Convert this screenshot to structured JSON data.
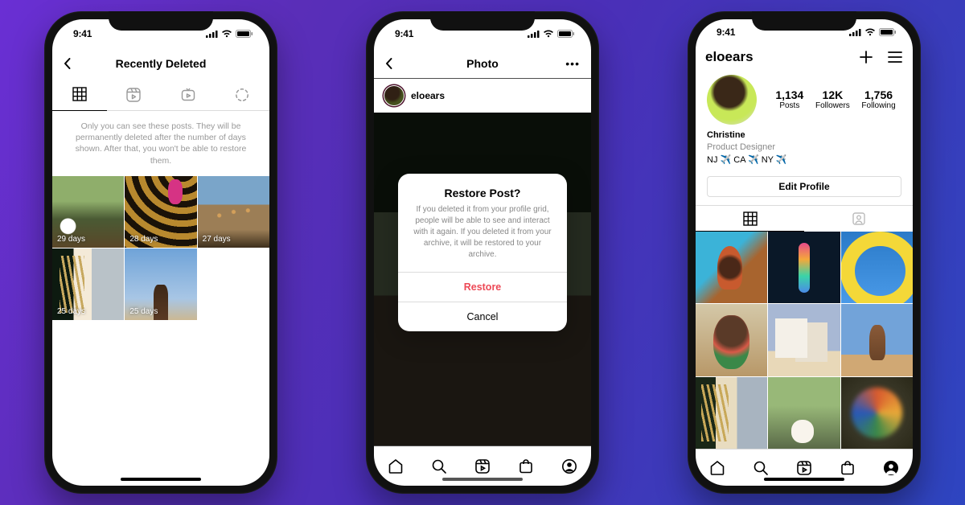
{
  "status": {
    "time": "9:41"
  },
  "phone1": {
    "title": "Recently Deleted",
    "notice": "Only you can see these posts. They will be permanently deleted after the number of days shown. After that, you won't be able to restore them.",
    "items": [
      {
        "remaining": "29 days"
      },
      {
        "remaining": "28 days"
      },
      {
        "remaining": "27 days"
      },
      {
        "remaining": "25 days"
      },
      {
        "remaining": "25 days"
      }
    ]
  },
  "phone2": {
    "title": "Photo",
    "username": "eloears",
    "modal": {
      "title": "Restore Post?",
      "body": "If you deleted it from your profile grid, people will be able to see and interact with it again. If you deleted it from your archive, it will be restored to your archive.",
      "restore": "Restore",
      "cancel": "Cancel"
    }
  },
  "phone3": {
    "username": "eloears",
    "stats": {
      "posts": {
        "num": "1,134",
        "label": "Posts"
      },
      "followers": {
        "num": "12K",
        "label": "Followers"
      },
      "following": {
        "num": "1,756",
        "label": "Following"
      }
    },
    "bio": {
      "name": "Christine",
      "title": "Product Designer",
      "location": "NJ ✈️ CA ✈️ NY ✈️"
    },
    "edit": "Edit Profile"
  }
}
